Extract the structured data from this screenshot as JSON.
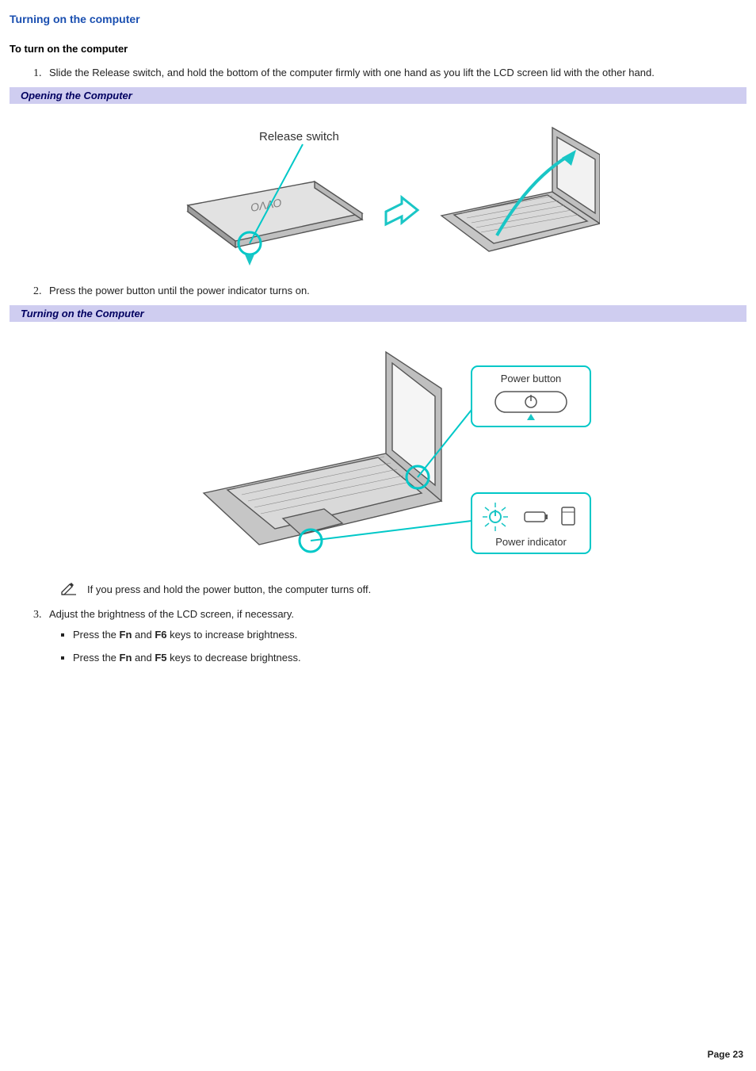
{
  "title": "Turning on the computer",
  "subheading": "To turn on the computer",
  "steps": {
    "s1": "Slide the Release switch, and hold the bottom of the computer firmly with one hand as you lift the LCD screen lid with the other hand.",
    "s2": "Press the power button until the power indicator turns on.",
    "s3": "Adjust the brightness of the LCD screen, if necessary."
  },
  "bars": {
    "opening": "Opening the Computer",
    "turning_on": "Turning on the Computer"
  },
  "figure1": {
    "release_switch": "Release switch"
  },
  "figure2": {
    "power_button": "Power button",
    "power_indicator": "Power indicator"
  },
  "note": "If you press and hold the power button, the computer turns off.",
  "bullets": {
    "b1": {
      "pre": "Press the ",
      "k1": "Fn",
      "mid": " and ",
      "k2": "F6",
      "post": " keys to increase brightness."
    },
    "b2": {
      "pre": "Press the ",
      "k1": "Fn",
      "mid": " and ",
      "k2": "F5",
      "post": " keys to decrease brightness."
    }
  },
  "footer": "Page 23"
}
